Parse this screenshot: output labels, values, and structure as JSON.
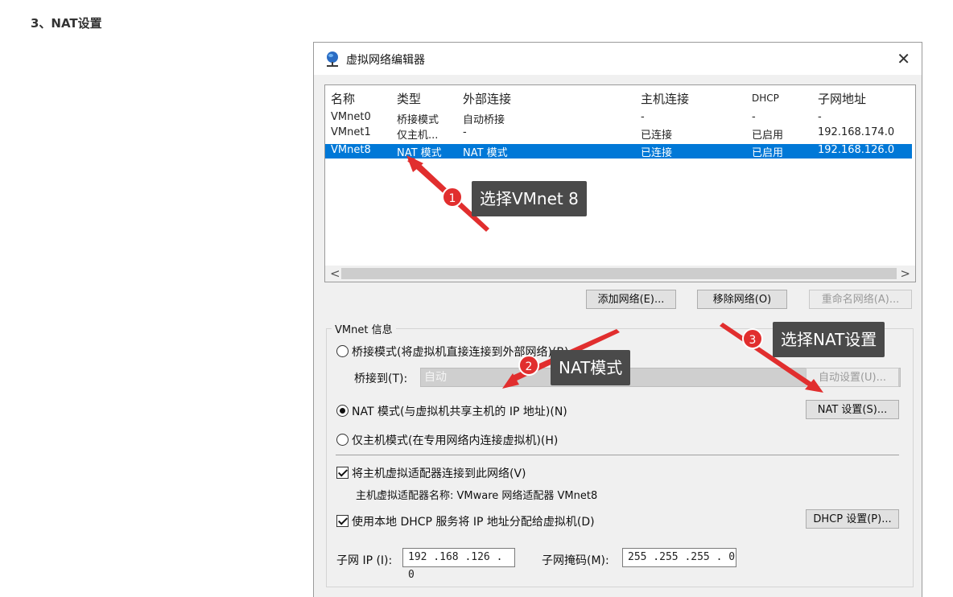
{
  "article": {
    "heading": "3、NAT设置"
  },
  "dialog": {
    "title": "虚拟网络编辑器",
    "close_label": "✕",
    "columns": [
      "名称",
      "类型",
      "外部连接",
      "主机连接",
      "DHCP",
      "子网地址"
    ],
    "rows": [
      [
        "VMnet0",
        "桥接模式",
        "自动桥接",
        "-",
        "-",
        "-"
      ],
      [
        "VMnet1",
        "仅主机...",
        "-",
        "已连接",
        "已启用",
        "192.168.174.0"
      ],
      [
        "VMnet8",
        "NAT 模式",
        "NAT 模式",
        "已连接",
        "已启用",
        "192.168.126.0"
      ]
    ],
    "selected_row": 2,
    "scroll_left": "<",
    "scroll_right": ">",
    "buttons": {
      "add": "添加网络(E)...",
      "remove": "移除网络(O)",
      "rename": "重命名网络(A)..."
    },
    "vmnet_info": {
      "label": "VMnet 信息",
      "bridged": "桥接模式(将虚拟机直接连接到外部网络)(B)",
      "bridged_to_label": "桥接到(T):",
      "bridged_to_value": "自动",
      "auto_settings": "自动设置(U)...",
      "nat": "NAT 模式(与虚拟机共享主机的 IP 地址)(N)",
      "nat_settings": "NAT 设置(S)...",
      "host_only": "仅主机模式(在专用网络内连接虚拟机)(H)",
      "selected_mode": "nat",
      "connect_adapter": "将主机虚拟适配器连接到此网络(V)",
      "adapter_name": "主机虚拟适配器名称: VMware 网络适配器 VMnet8",
      "use_dhcp": "使用本地 DHCP 服务将 IP 地址分配给虚拟机(D)",
      "dhcp_settings": "DHCP 设置(P)...",
      "subnet_ip_label": "子网 IP (I):",
      "subnet_ip": "192 .168 .126 .  0",
      "subnet_mask_label": "子网掩码(M):",
      "subnet_mask": "255 .255 .255 .  0"
    }
  },
  "annotations": [
    {
      "number": "1",
      "text": "选择VMnet 8",
      "color": "#e12e2e"
    },
    {
      "number": "2",
      "text": "NAT模式",
      "color": "#e12e2e"
    },
    {
      "number": "3",
      "text": "选择NAT设置",
      "color": "#e12e2e"
    }
  ]
}
